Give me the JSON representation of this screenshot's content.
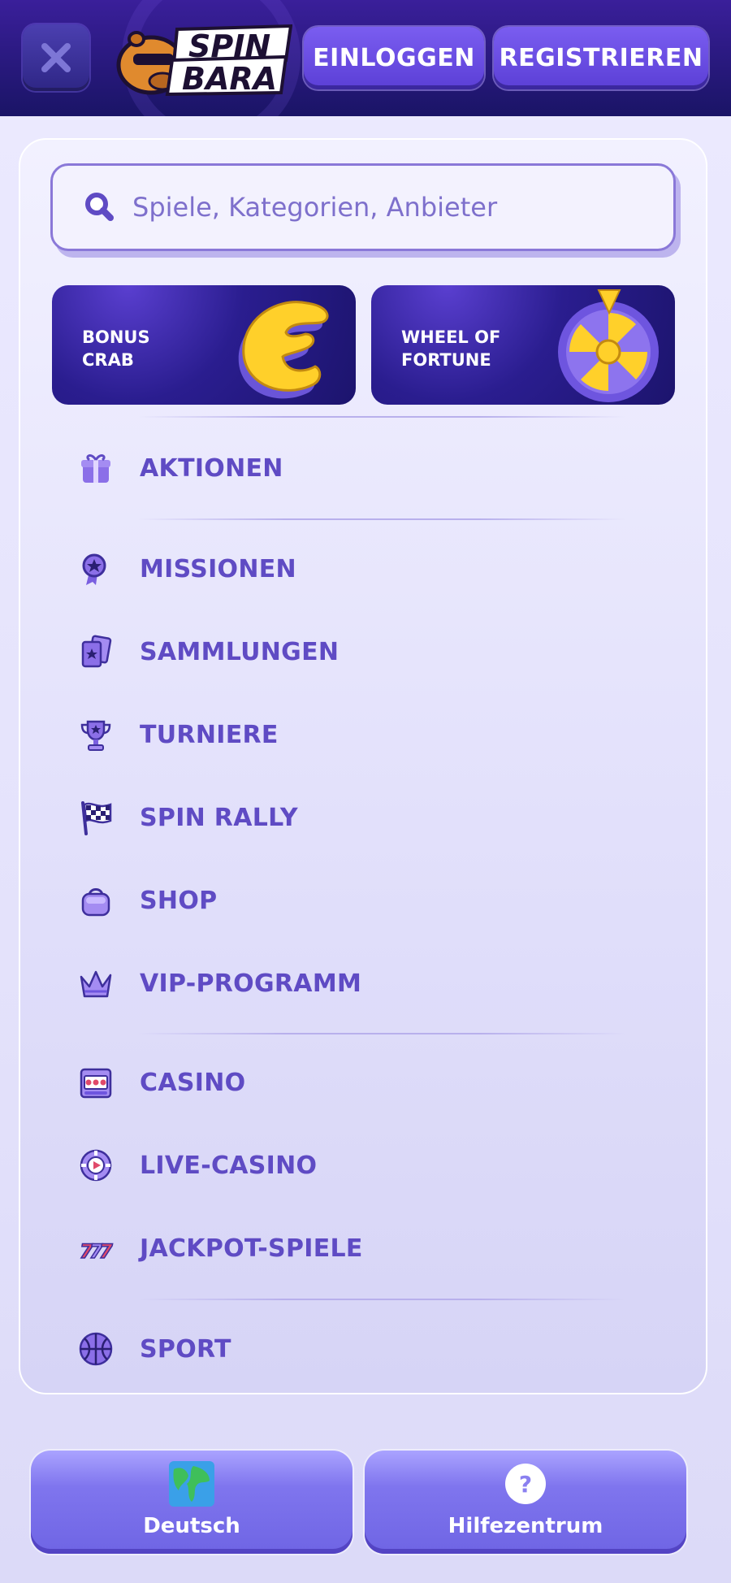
{
  "header": {
    "logo_text_top": "SPIN",
    "logo_text_bottom": "BARA",
    "login_label": "EINLOGGEN",
    "register_label": "REGISTRIEREN"
  },
  "search": {
    "placeholder": "Spiele, Kategorien, Anbieter",
    "value": ""
  },
  "promos": [
    {
      "label": "BONUS\nCRAB",
      "icon": "crab-claw-icon"
    },
    {
      "label": "WHEEL OF\nFORTUNE",
      "icon": "wheel-icon"
    }
  ],
  "menu": {
    "group1": [
      {
        "label": "AKTIONEN",
        "icon": "gift-icon"
      }
    ],
    "group2": [
      {
        "label": "MISSIONEN",
        "icon": "medal-icon"
      },
      {
        "label": "SAMMLUNGEN",
        "icon": "cards-icon"
      },
      {
        "label": "TURNIERE",
        "icon": "trophy-icon"
      },
      {
        "label": "SPIN RALLY",
        "icon": "checkered-flag-icon"
      },
      {
        "label": "SHOP",
        "icon": "shopping-bag-icon"
      },
      {
        "label": "VIP-PROGRAMM",
        "icon": "crown-icon"
      }
    ],
    "group3": [
      {
        "label": "CASINO",
        "icon": "slot-machine-icon"
      },
      {
        "label": "LIVE-CASINO",
        "icon": "casino-chip-icon"
      },
      {
        "label": "JACKPOT-SPIELE",
        "icon": "sevens-icon"
      }
    ],
    "group4": [
      {
        "label": "SPORT",
        "icon": "basketball-icon"
      }
    ]
  },
  "footer": {
    "language_label": "Deutsch",
    "help_label": "Hilfezentrum"
  },
  "colors": {
    "header_bg": "#1a1466",
    "accent": "#5f4bc4",
    "button": "#6b4fe0",
    "card_bg": "#eceaff"
  }
}
